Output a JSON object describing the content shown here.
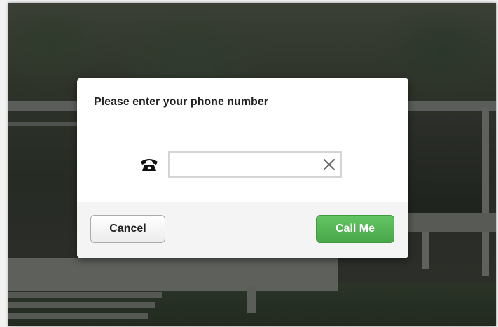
{
  "dialog": {
    "title": "Please enter your phone number",
    "phone_input": {
      "value": "",
      "placeholder": ""
    },
    "cancel_label": "Cancel",
    "call_label": "Call Me"
  },
  "icons": {
    "phone": "phone-icon",
    "clear": "clear-icon"
  },
  "colors": {
    "call_button": "#52b452",
    "call_button_text": "#ffffff",
    "backdrop": "#2b3028"
  }
}
